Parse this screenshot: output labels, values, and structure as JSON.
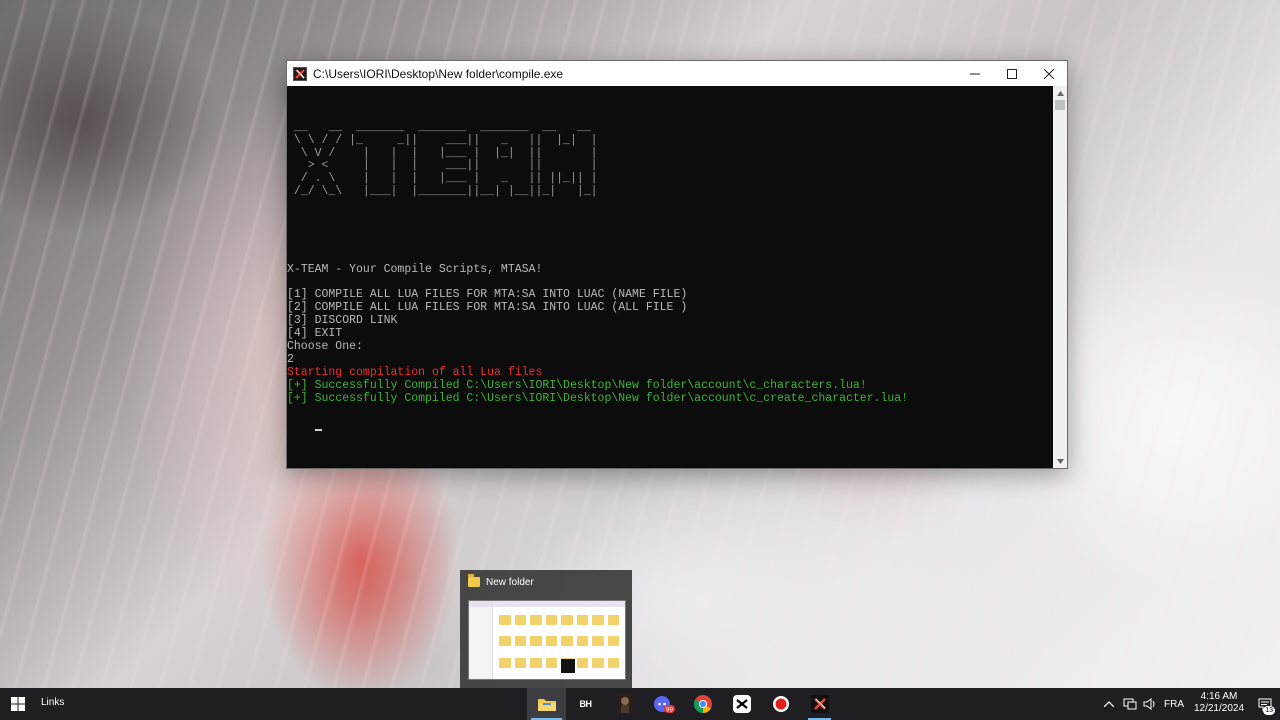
{
  "console": {
    "title": "C:\\Users\\IORI\\Desktop\\New folder\\compile.exe",
    "ascii_banner": [
      " __   __  _______  _______  _______  __   __ ",
      " \\ \\ / / |_     _||    ___||   _   ||  |_|  |",
      "  \\ V /    |   |  |   |___ |  |_|  ||       |",
      "   > <     |   |  |    ___||       ||       |",
      "  / . \\    |   |  |   |___ |   _   || ||_|| |",
      " /_/ \\_\\   |___|  |_______||__| |__||_|   |_|"
    ],
    "lines": [
      {
        "text": "X-TEAM - Your Compile Scripts, MTASA!",
        "style": "normal"
      },
      {
        "text": "",
        "style": "normal"
      },
      {
        "text": "[1] COMPILE ALL LUA FILES FOR MTA:SA INTO LUAC (NAME FILE)",
        "style": "normal"
      },
      {
        "text": "[2] COMPILE ALL LUA FILES FOR MTA:SA INTO LUAC (ALL FILE )",
        "style": "normal"
      },
      {
        "text": "[3] DISCORD LINK",
        "style": "normal"
      },
      {
        "text": "[4] EXIT",
        "style": "normal"
      },
      {
        "text": "Choose One:",
        "style": "normal"
      },
      {
        "text": "2",
        "style": "normal"
      },
      {
        "text": "Starting compilation of all Lua files",
        "style": "red"
      },
      {
        "text": "[+] Successfully Compiled C:\\Users\\IORI\\Desktop\\New folder\\account\\c_characters.lua!",
        "style": "green"
      },
      {
        "text": "[+] Successfully Compiled C:\\Users\\IORI\\Desktop\\New folder\\account\\c_create_character.lua!",
        "style": "green"
      }
    ],
    "colors": {
      "background": "#0c0c0c",
      "text": "#b9b9b9",
      "error": "#e8322c",
      "success": "#3fb23a"
    }
  },
  "preview": {
    "title": "New folder"
  },
  "taskbar": {
    "links_label": "Links",
    "apps": [
      {
        "name": "file-explorer",
        "icon": "folder-icon",
        "state": "active"
      },
      {
        "name": "bh-app",
        "icon": "bh-text-icon",
        "label": "BH",
        "state": "normal"
      },
      {
        "name": "game-app",
        "icon": "game-character-icon",
        "state": "normal"
      },
      {
        "name": "discord",
        "icon": "discord-icon",
        "badge": "99",
        "state": "normal"
      },
      {
        "name": "chrome",
        "icon": "chrome-icon",
        "state": "normal"
      },
      {
        "name": "capcut",
        "icon": "capcut-icon",
        "state": "normal"
      },
      {
        "name": "recorder",
        "icon": "record-icon",
        "state": "normal"
      },
      {
        "name": "compile-exe",
        "icon": "x-team-icon",
        "state": "running"
      }
    ],
    "tray": {
      "language": "FRA",
      "time": "4:16 AM",
      "date": "12/21/2024",
      "notifications": "13"
    }
  }
}
